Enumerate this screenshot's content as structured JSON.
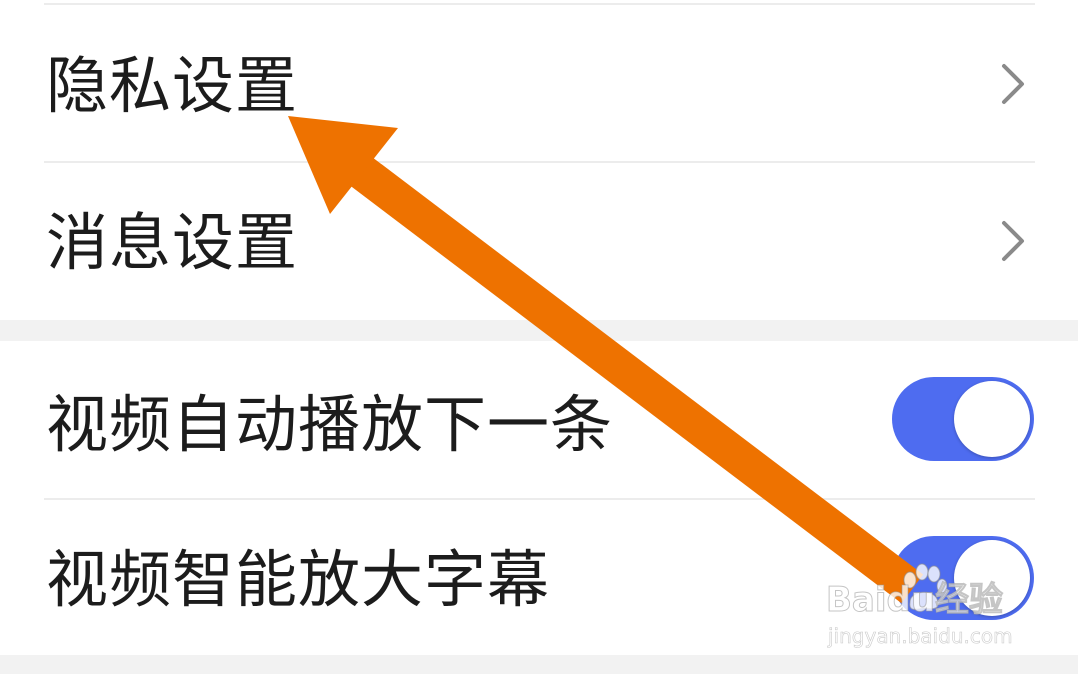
{
  "settings": {
    "privacy": {
      "label": "隐私设置"
    },
    "message": {
      "label": "消息设置"
    },
    "autoplay_next": {
      "label": "视频自动播放下一条",
      "enabled": true
    },
    "smart_subtitles": {
      "label": "视频智能放大字幕",
      "enabled": true
    }
  },
  "watermark": {
    "brand": "Baidu经验",
    "url": "jingyan.baidu.com"
  },
  "colors": {
    "toggle_on": "#4e6cf0",
    "annotation_arrow": "#ee7200",
    "background": "#f2f2f2",
    "surface": "#ffffff"
  }
}
